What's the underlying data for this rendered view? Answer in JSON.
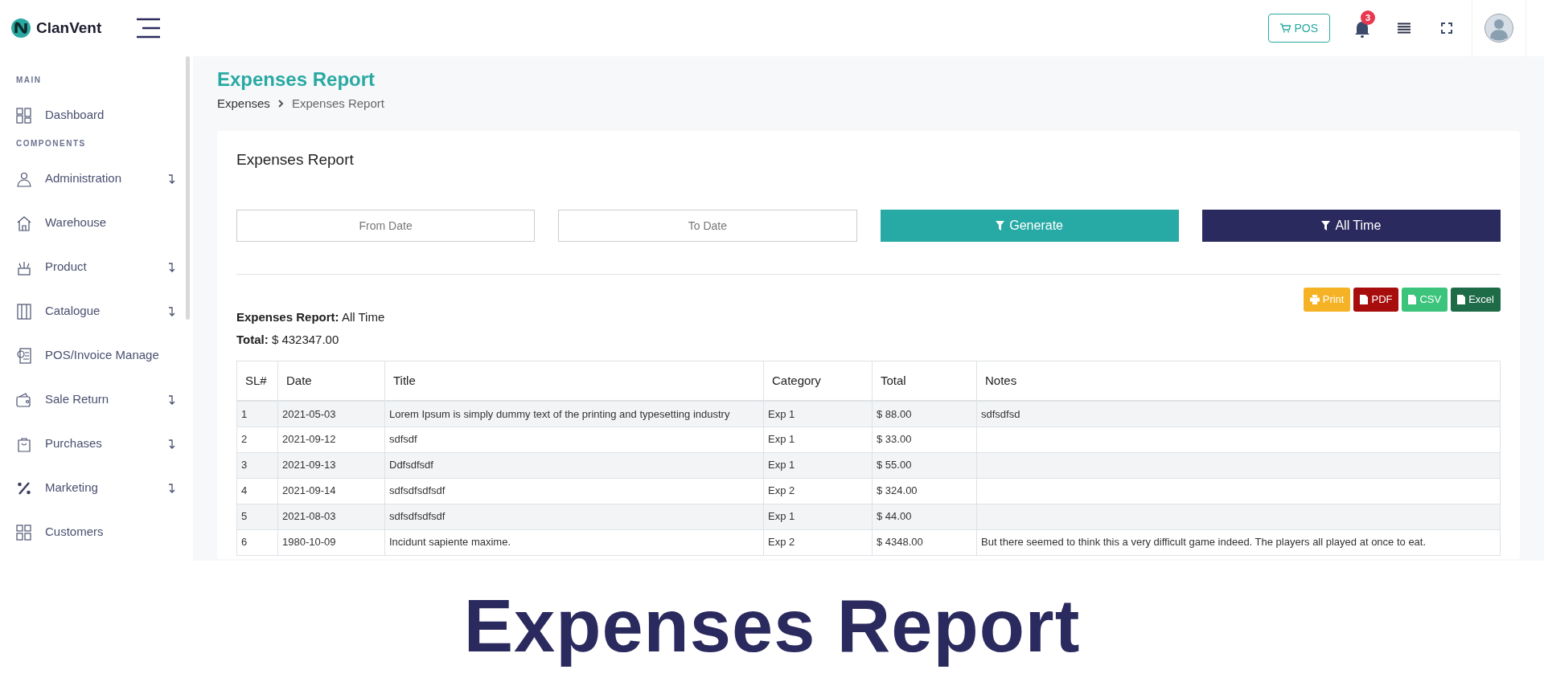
{
  "header": {
    "brand": "ClanVent",
    "pos_button": "POS",
    "notification_count": "3"
  },
  "sidebar": {
    "sections": [
      {
        "label": "MAIN",
        "items": [
          {
            "label": "Dashboard",
            "expandable": false
          }
        ]
      },
      {
        "label": "COMPONENTS",
        "items": [
          {
            "label": "Administration",
            "expandable": true
          },
          {
            "label": "Warehouse",
            "expandable": false
          },
          {
            "label": "Product",
            "expandable": true
          },
          {
            "label": "Catalogue",
            "expandable": true
          },
          {
            "label": "POS/Invoice Manage",
            "expandable": false
          },
          {
            "label": "Sale Return",
            "expandable": true
          },
          {
            "label": "Purchases",
            "expandable": true
          },
          {
            "label": "Marketing",
            "expandable": true
          },
          {
            "label": "Customers",
            "expandable": false
          }
        ]
      }
    ]
  },
  "page": {
    "title": "Expenses Report",
    "breadcrumb": [
      "Expenses",
      "Expenses Report"
    ]
  },
  "card": {
    "title": "Expenses Report",
    "filters": {
      "from_placeholder": "From Date",
      "to_placeholder": "To Date",
      "generate_button": "Generate",
      "all_time_button": "All Time"
    },
    "export_buttons": [
      {
        "label": "Print",
        "color": "#f5b225"
      },
      {
        "label": "PDF",
        "color": "#a80d0d"
      },
      {
        "label": "CSV",
        "color": "#3cc47c"
      },
      {
        "label": "Excel",
        "color": "#1e6b47"
      }
    ],
    "summary": [
      {
        "label": "Expenses Report:",
        "value": "All Time"
      },
      {
        "label": "Total:",
        "value": "$ 432347.00"
      }
    ],
    "table": {
      "columns": [
        "SL#",
        "Date",
        "Title",
        "Category",
        "Total",
        "Notes"
      ],
      "rows": [
        [
          "1",
          "2021-05-03",
          "Lorem Ipsum is simply dummy text of the printing and typesetting industry",
          "Exp 1",
          "$ 88.00",
          "sdfsdfsd"
        ],
        [
          "2",
          "2021-09-12",
          "sdfsdf",
          "Exp 1",
          "$ 33.00",
          ""
        ],
        [
          "3",
          "2021-09-13",
          "Ddfsdfsdf",
          "Exp 1",
          "$ 55.00",
          ""
        ],
        [
          "4",
          "2021-09-14",
          "sdfsdfsdfsdf",
          "Exp 2",
          "$ 324.00",
          ""
        ],
        [
          "5",
          "2021-08-03",
          "sdfsdfsdfsdf",
          "Exp 1",
          "$ 44.00",
          ""
        ],
        [
          "6",
          "1980-10-09",
          "Incidunt sapiente maxime.",
          "Exp 2",
          "$ 4348.00",
          "But there seemed to think this a very difficult game indeed. The players all played at once to eat."
        ]
      ]
    }
  },
  "caption": "Expenses Report"
}
